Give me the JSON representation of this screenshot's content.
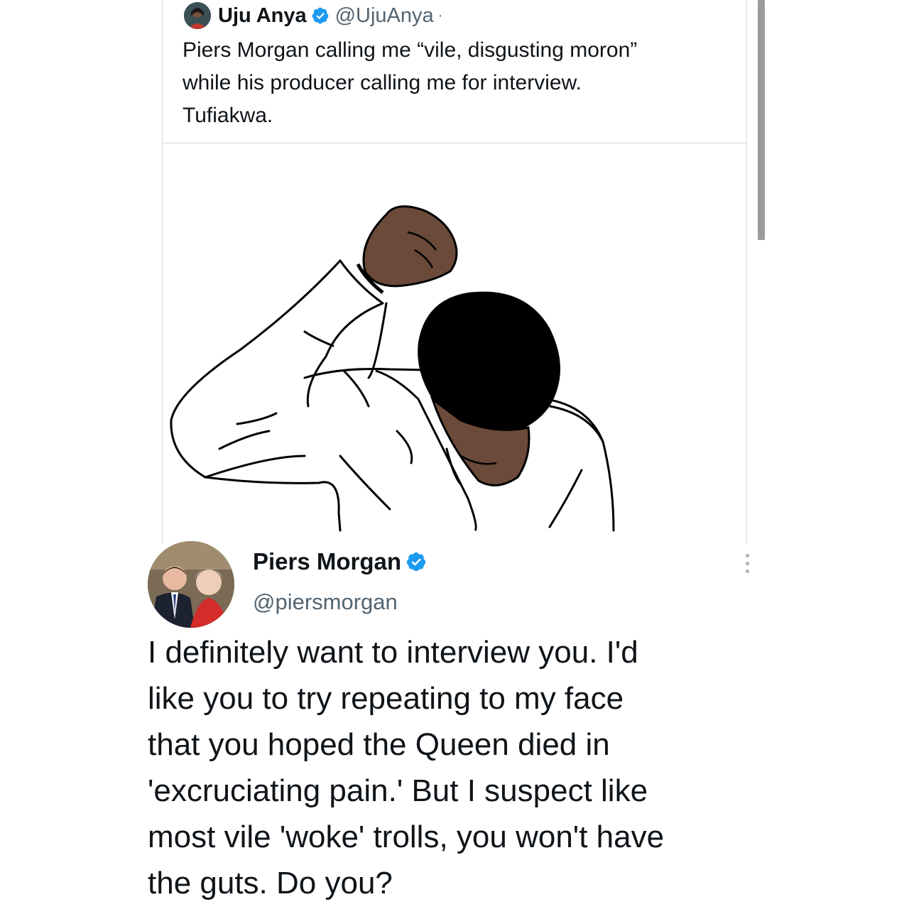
{
  "quoted_tweet": {
    "author_name": "Uju Anya",
    "author_handle": "@UjuAnya",
    "separator": "·",
    "avatar_icon": "profile-photo",
    "verified_icon": "verified-badge-icon",
    "text": "Piers Morgan calling me “vile, disgusting moron”\nwhile his producer calling me for interview.\nTufiakwa.",
    "image_icon": "man-dab-illustration"
  },
  "main_tweet": {
    "author_name": "Piers Morgan",
    "author_handle": "@piersmorgan",
    "avatar_icon": "profile-photo",
    "verified_icon": "verified-badge-icon",
    "more_icon": "vertical-ellipsis-icon",
    "text": "I definitely want to interview you. I'd\nlike you to try repeating to my face\nthat you hoped the Queen died in\n'excruciating pain.' But I suspect like\nmost vile 'woke' trolls, you won't have\nthe guts. Do you?"
  },
  "colors": {
    "verified": "#1d9bf0",
    "text_primary": "#0f1419",
    "text_secondary": "#536471",
    "skin": "#6b4a3a",
    "hair": "#000000"
  }
}
